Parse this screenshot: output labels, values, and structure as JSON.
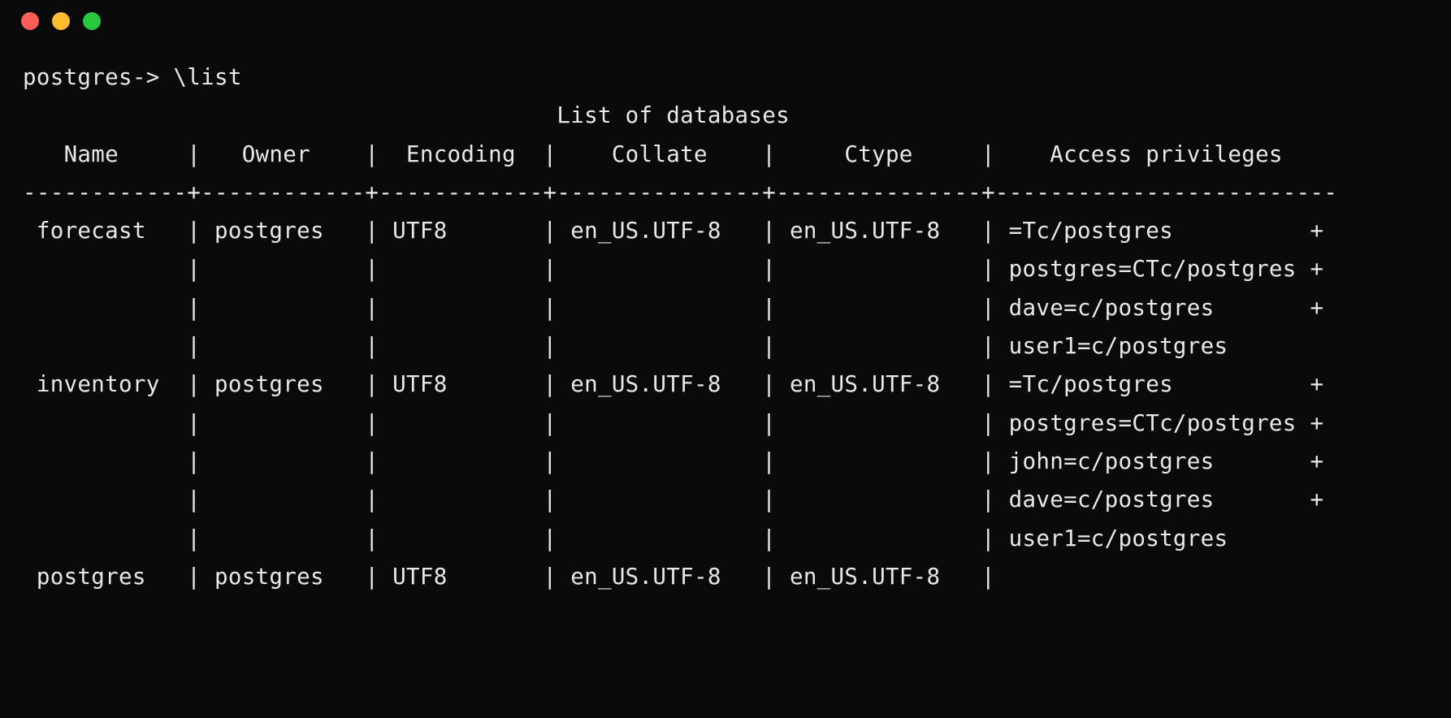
{
  "prompt": "postgres-> \\list",
  "table": {
    "title": "List of databases",
    "columns": {
      "name": "Name",
      "owner": "Owner",
      "encoding": "Encoding",
      "collate": "Collate",
      "ctype": "Ctype",
      "access": "Access privileges"
    },
    "rows": [
      {
        "name": "forecast",
        "owner": "postgres",
        "encoding": "UTF8",
        "collate": "en_US.UTF-8",
        "ctype": "en_US.UTF-8",
        "access": [
          "=Tc/postgres",
          "postgres=CTc/postgres",
          "dave=c/postgres",
          "user1=c/postgres"
        ]
      },
      {
        "name": "inventory",
        "owner": "postgres",
        "encoding": "UTF8",
        "collate": "en_US.UTF-8",
        "ctype": "en_US.UTF-8",
        "access": [
          "=Tc/postgres",
          "postgres=CTc/postgres",
          "john=c/postgres",
          "dave=c/postgres",
          "user1=c/postgres"
        ]
      },
      {
        "name": "postgres",
        "owner": "postgres",
        "encoding": "UTF8",
        "collate": "en_US.UTF-8",
        "ctype": "en_US.UTF-8",
        "access": []
      }
    ],
    "widths": {
      "name": 11,
      "owner": 10,
      "encoding": 10,
      "collate": 13,
      "ctype": 13,
      "access": 23
    }
  }
}
